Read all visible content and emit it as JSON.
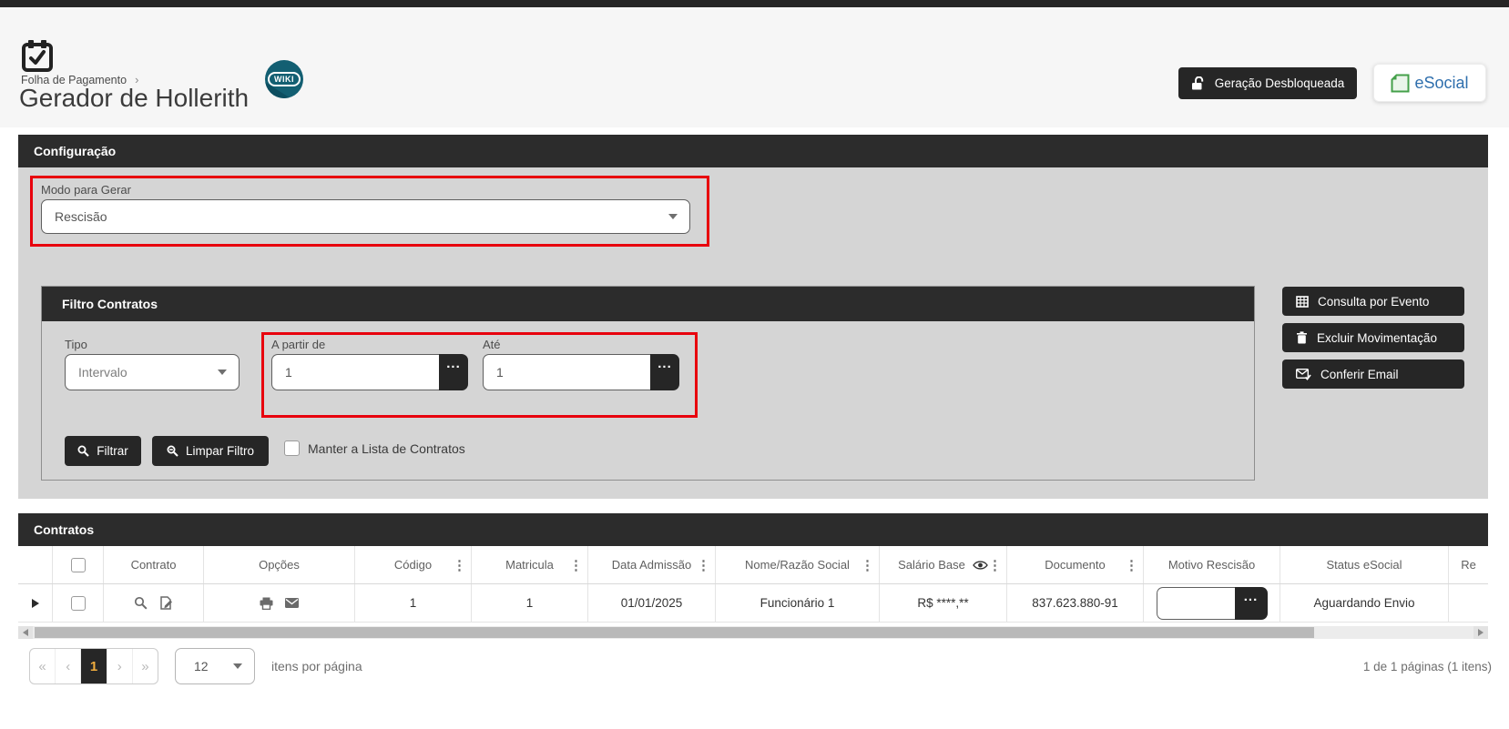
{
  "page": {
    "breadcrumb": "Folha de Pagamento",
    "breadcrumb_separator": "›",
    "title": "Gerador de Hollerith",
    "wiki_badge": "WIKI",
    "lock_button": "Geração Desbloqueada",
    "esocial_button": "eSocial"
  },
  "configuracao": {
    "title": "Configuração",
    "modo_label": "Modo para Gerar",
    "modo_value": "Rescisão"
  },
  "filtro": {
    "title": "Filtro Contratos",
    "tipo_label": "Tipo",
    "tipo_value": "Intervalo",
    "a_partir_de_label": "A partir de",
    "a_partir_de_value": "1",
    "ate_label": "Até",
    "ate_value": "1",
    "lookup_button": "...",
    "filtrar_button": "Filtrar",
    "limpar_button": "Limpar Filtro",
    "manter_checkbox_label": "Manter a Lista de Contratos"
  },
  "acoes": {
    "consulta_por_evento": "Consulta por Evento",
    "excluir_movimentacao": "Excluir Movimentação",
    "conferir_email": "Conferir Email"
  },
  "contratos": {
    "title": "Contratos",
    "headers": {
      "contrato": "Contrato",
      "opcoes": "Opções",
      "codigo": "Código",
      "matricula": "Matricula",
      "data_admissao": "Data Admissão",
      "nome_razao_social": "Nome/Razão Social",
      "salario_base": "Salário Base",
      "documento": "Documento",
      "motivo_rescisao": "Motivo Rescisão",
      "status_esocial": "Status eSocial",
      "re_cortado": "Re"
    },
    "row": {
      "codigo": "1",
      "matricula": "1",
      "data_admissao": "01/01/2025",
      "nome_razao_social": "Funcionário 1",
      "salario_base": "R$ ****,**",
      "documento": "837.623.880-91",
      "motivo_rescisao_value": "",
      "lookup_button": "...",
      "status_esocial": "Aguardando Envio"
    }
  },
  "pagination": {
    "first": "«",
    "prev": "‹",
    "page": "1",
    "next": "›",
    "last": "»",
    "page_size": "12",
    "items_label": "itens por página",
    "summary": "1 de 1 páginas (1 itens)"
  },
  "icons": {
    "calendar-check": "calendar with checkmark",
    "unlock": "open padlock",
    "esocial-page": "green folded page",
    "grid": "table grid",
    "trash": "trash can",
    "mail-check": "envelope with checkmark",
    "search": "magnifier",
    "kebab": "⋮",
    "eye": "visibility eye",
    "edit-document": "document with pencil",
    "printer": "printer",
    "envelope": "envelope",
    "expander": "▶",
    "caret": "▼",
    "ellipsis": "..."
  },
  "colors": {
    "dark_bar": "#2c2c2c",
    "dark_button": "#262626",
    "panel_gray": "#d5d5d5",
    "annotation_red": "#e8000d",
    "esocial_blue": "#2f6fad",
    "esocial_green": "#44a04a",
    "wiki_teal": "#135f72",
    "pager_active_text": "#f0ac3e"
  }
}
